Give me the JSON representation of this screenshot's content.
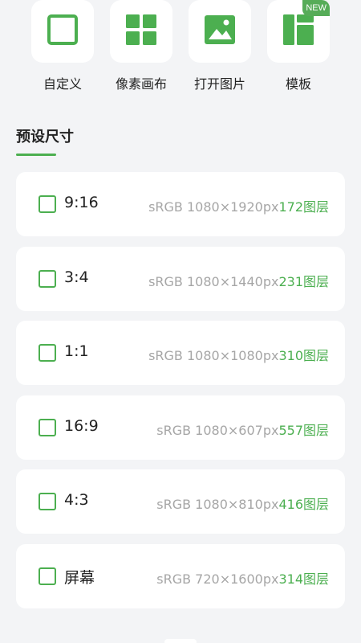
{
  "tools": [
    {
      "label": "自定义",
      "icon": "square-outline-icon"
    },
    {
      "label": "像素画布",
      "icon": "grid-icon"
    },
    {
      "label": "打开图片",
      "icon": "image-icon"
    },
    {
      "label": "模板",
      "icon": "template-icon",
      "badge": "NEW"
    }
  ],
  "section": {
    "title": "预设尺寸"
  },
  "presets": [
    {
      "ratio": "9:16",
      "spec": "sRGB 1080×1920px",
      "layers": "172图层"
    },
    {
      "ratio": "3:4",
      "spec": "sRGB 1080×1440px",
      "layers": "231图层"
    },
    {
      "ratio": "1:1",
      "spec": "sRGB 1080×1080px",
      "layers": "310图层"
    },
    {
      "ratio": "16:9",
      "spec": "sRGB 1080×607px",
      "layers": "557图层"
    },
    {
      "ratio": "4:3",
      "spec": "sRGB 1080×810px",
      "layers": "416图层"
    },
    {
      "ratio": "屏幕",
      "spec": "sRGB 720×1600px",
      "layers": "314图层"
    }
  ],
  "colors": {
    "accent": "#4caf50",
    "background": "#f3f4f6",
    "card": "#ffffff",
    "muted_text": "#a6a6a6"
  }
}
